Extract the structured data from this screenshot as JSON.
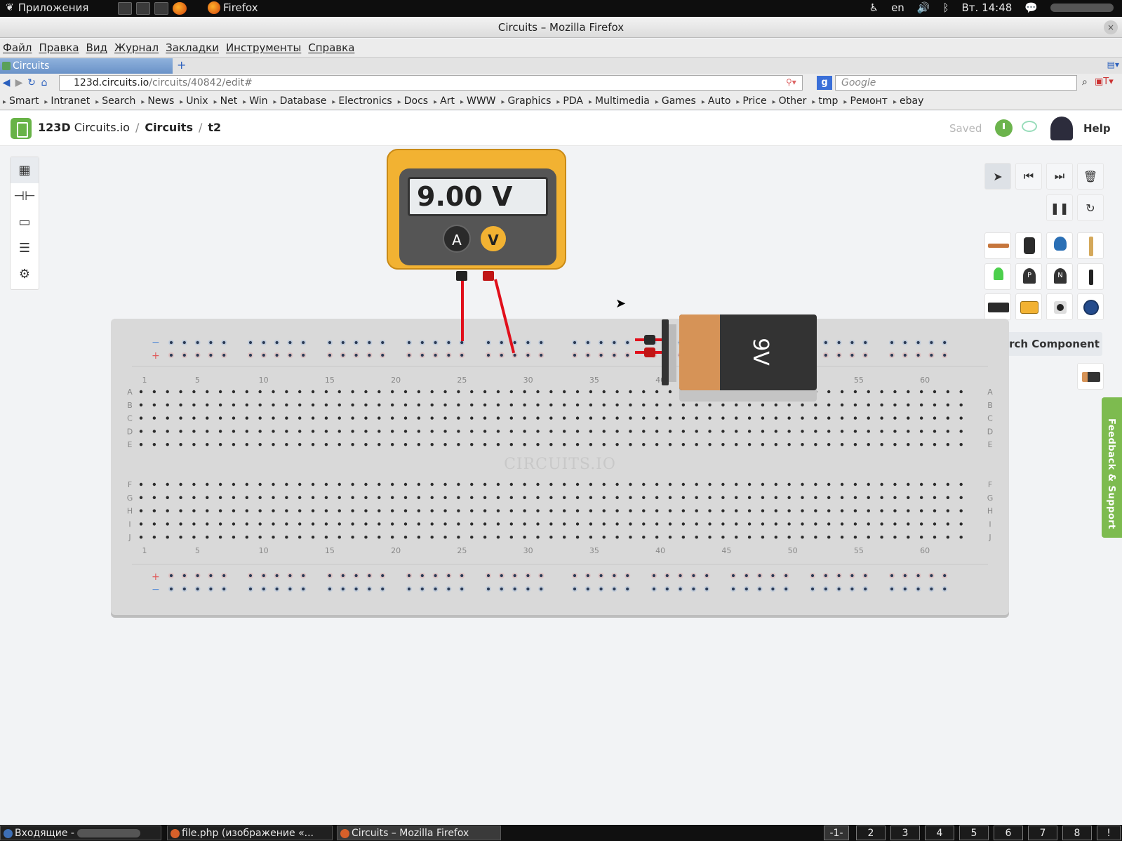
{
  "system": {
    "apps_label": "Приложения",
    "firefox_label": "Firefox",
    "lang": "en",
    "clock": "Вт. 14:48"
  },
  "window": {
    "title": "Circuits – Mozilla Firefox",
    "close": "×"
  },
  "menu": [
    "Файл",
    "Правка",
    "Вид",
    "Журнал",
    "Закладки",
    "Инструменты",
    "Справка"
  ],
  "tab": {
    "label": "Circuits",
    "new": "+"
  },
  "nav": {
    "url_host": "123d.circuits.io",
    "url_path": "/circuits/40842/edit#",
    "search_placeholder": "Google",
    "search_engine": "g"
  },
  "bookmarks": [
    "Smart",
    "Intranet",
    "Search",
    "News",
    "Unix",
    "Net",
    "Win",
    "Database",
    "Electronics",
    "Docs",
    "Art",
    "WWW",
    "Graphics",
    "PDA",
    "Multimedia",
    "Games",
    "Auto",
    "Price",
    "Other",
    "tmp",
    "Ремонт",
    "ebay"
  ],
  "app": {
    "brand_prefix": "123D",
    "brand": "Circuits.io",
    "crumb_section": "Circuits",
    "crumb_project": "t2",
    "saved": "Saved",
    "help": "Help"
  },
  "left_tools": [
    {
      "name": "breadboard-icon",
      "glyph": "▦"
    },
    {
      "name": "schematic-icon",
      "glyph": "⊣⊢"
    },
    {
      "name": "pcb-icon",
      "glyph": "▭"
    },
    {
      "name": "bom-list-icon",
      "glyph": "☰"
    },
    {
      "name": "settings-gear-icon",
      "glyph": "⚙"
    }
  ],
  "sim_tools": {
    "pointer": "➤",
    "prev": "⏮",
    "next": "⏭",
    "delete": "🗑",
    "pause": "❚❚",
    "reload": "↻"
  },
  "components_panel": {
    "search_label": "Search Component"
  },
  "feedback": {
    "label": "Feedback & Support"
  },
  "multimeter": {
    "reading": "9.00 V",
    "mode_a": "A",
    "mode_v": "V",
    "active_mode": "V"
  },
  "battery": {
    "label": "9V"
  },
  "breadboard": {
    "watermark": "CIRCUITS.IO",
    "rows_top": [
      "A",
      "B",
      "C",
      "D",
      "E"
    ],
    "rows_bottom": [
      "F",
      "G",
      "H",
      "I",
      "J"
    ],
    "col_labels": [
      "1",
      "5",
      "10",
      "15",
      "20",
      "25",
      "30",
      "35",
      "40",
      "45",
      "50",
      "55",
      "60"
    ],
    "rail_minus": "−",
    "rail_plus": "+"
  },
  "taskbar": {
    "items": [
      "Входящие -",
      "file.php (изображение «...",
      "Circuits – Mozilla Firefox"
    ],
    "workspaces": [
      "-1-",
      "2",
      "3",
      "4",
      "5",
      "6",
      "7",
      "8",
      "!"
    ]
  },
  "colors": {
    "accent_green": "#68b347",
    "meter_yellow": "#f2b232",
    "wire_red": "#e10f1b",
    "battery_orange": "#d69357"
  }
}
